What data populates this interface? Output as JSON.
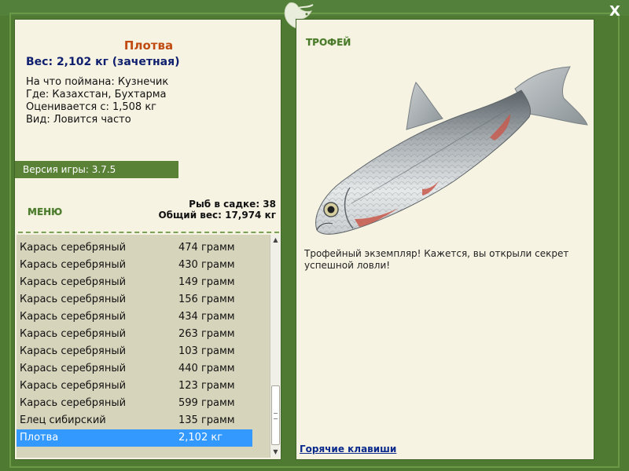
{
  "window": {
    "close_label": "X"
  },
  "colors": {
    "frame": "#4e7a32",
    "panel": "#f6f3e3",
    "accent_green": "#5a8237",
    "name_orange": "#c04a10",
    "weight_blue": "#10206e",
    "selection": "#3399ff"
  },
  "fish": {
    "name": "Плотва",
    "weight": "Вес: 2,102 кг (зачетная)",
    "bait": "На что поймана: Кузнечик",
    "place": "Где: Казахстан, Бухтарма",
    "price": "Оценивается с: 1,508 кг",
    "kind": "Вид: Ловится часто"
  },
  "version": "Версия игры: 3.7.5",
  "menu_title": "МЕНЮ",
  "stats": {
    "count": "Рыб в садке: 38",
    "total": "Общий вес: 17,974 кг"
  },
  "catch_list": [
    {
      "name": "Карась серебряный",
      "weight": "474 грамм"
    },
    {
      "name": "Карась серебряный",
      "weight": "430 грамм"
    },
    {
      "name": "Карась серебряный",
      "weight": "149 грамм"
    },
    {
      "name": "Карась серебряный",
      "weight": "156 грамм"
    },
    {
      "name": "Карась серебряный",
      "weight": "434 грамм"
    },
    {
      "name": "Карась серебряный",
      "weight": "263 грамм"
    },
    {
      "name": "Карась серебряный",
      "weight": "103 грамм"
    },
    {
      "name": "Карась серебряный",
      "weight": "440 грамм"
    },
    {
      "name": "Карась серебряный",
      "weight": "123 грамм"
    },
    {
      "name": "Карась серебряный",
      "weight": "599 грамм"
    },
    {
      "name": "Елец сибирский",
      "weight": "135 грамм"
    },
    {
      "name": "Плотва",
      "weight": "2,102 кг"
    }
  ],
  "selected_index": 11,
  "trophy": {
    "title": "ТРОФЕЙ",
    "text": "Трофейный экземпляр! Кажется, вы открыли секрет успешной ловли!"
  },
  "hotkeys_label": "Горячие клавиши",
  "icons": {
    "logo": "fish-logo-icon",
    "fish_picture": "roach-fish-icon"
  }
}
